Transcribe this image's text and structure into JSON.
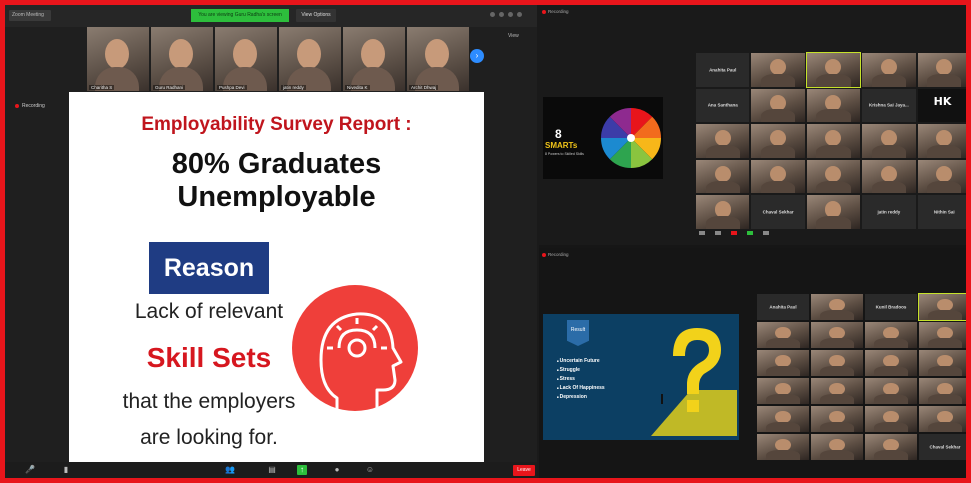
{
  "colors": {
    "border": "#e8151b",
    "share_banner": "#2dbe3c",
    "slide_title": "#c0151d",
    "reason_box": "#1f3c83",
    "skill_sets": "#d6171f",
    "head_circle": "#ef3f3a",
    "zoom_blue": "#2d8cff"
  },
  "left": {
    "zoom_badge": "Zoom Meeting",
    "share_banner": "You are viewing Guru Radha's screen",
    "view_options": "View Options",
    "view_button": "View",
    "recording": "Recording",
    "thumbnails": [
      {
        "name": "Charitha S"
      },
      {
        "name": "Guru Radhani"
      },
      {
        "name": "Pushpa Devi"
      },
      {
        "name": "jatin reddy"
      },
      {
        "name": "Nivedita K"
      },
      {
        "name": "Archit Dhwaj"
      }
    ],
    "slide": {
      "title": "Employability Survey Report :",
      "headline": "80% Graduates Unemployable",
      "reason_label": "Reason",
      "line1": "Lack of  relevant",
      "line2": "Skill Sets",
      "line3": "that the employers",
      "line4": "are looking for."
    },
    "end_button": "Leave",
    "toolbar_icons": [
      "mute-icon",
      "video-icon",
      "participants-icon",
      "chat-icon",
      "share-screen-icon",
      "record-icon",
      "reactions-icon"
    ]
  },
  "right": {
    "pane1": {
      "recording": "Recording",
      "smarts": {
        "number": "8",
        "label": "SMARTs",
        "subtitle": "8 Powers to Skilled Skills"
      },
      "tiles": [
        {
          "kind": "name",
          "label": "Anahita Paul"
        },
        {
          "kind": "video",
          "label": ""
        },
        {
          "kind": "video",
          "label": "",
          "highlight": true
        },
        {
          "kind": "video",
          "label": ""
        },
        {
          "kind": "video",
          "label": ""
        },
        {
          "kind": "name",
          "label": "Ana Santhana"
        },
        {
          "kind": "video",
          "label": ""
        },
        {
          "kind": "video",
          "label": ""
        },
        {
          "kind": "name",
          "label": "Krishna Sai Jaya..."
        },
        {
          "kind": "logo",
          "label": "HK"
        },
        {
          "kind": "video",
          "label": ""
        },
        {
          "kind": "video",
          "label": ""
        },
        {
          "kind": "video",
          "label": ""
        },
        {
          "kind": "video",
          "label": ""
        },
        {
          "kind": "video",
          "label": ""
        },
        {
          "kind": "video",
          "label": ""
        },
        {
          "kind": "video",
          "label": ""
        },
        {
          "kind": "video",
          "label": ""
        },
        {
          "kind": "video",
          "label": ""
        },
        {
          "kind": "video",
          "label": ""
        },
        {
          "kind": "video",
          "label": ""
        },
        {
          "kind": "name",
          "label": "Chaval Sekhar"
        },
        {
          "kind": "video",
          "label": ""
        },
        {
          "kind": "name",
          "label": "jatin reddy"
        },
        {
          "kind": "name",
          "label": "Nithin Sai"
        }
      ]
    },
    "pane2": {
      "recording": "Recording",
      "result": {
        "tag": "Result",
        "items": [
          "Uncertain Future",
          "Struggle",
          "Stress",
          "Lack Of Happiness",
          "Depression"
        ]
      },
      "tiles": [
        {
          "kind": "name",
          "label": "Anahita Paul"
        },
        {
          "kind": "video",
          "label": ""
        },
        {
          "kind": "name",
          "label": "Kunil Bradoos"
        },
        {
          "kind": "video",
          "label": "",
          "highlight": true
        },
        {
          "kind": "video",
          "label": ""
        },
        {
          "kind": "video",
          "label": ""
        },
        {
          "kind": "video",
          "label": ""
        },
        {
          "kind": "video",
          "label": ""
        },
        {
          "kind": "video",
          "label": ""
        },
        {
          "kind": "video",
          "label": ""
        },
        {
          "kind": "video",
          "label": ""
        },
        {
          "kind": "video",
          "label": ""
        },
        {
          "kind": "video",
          "label": ""
        },
        {
          "kind": "video",
          "label": ""
        },
        {
          "kind": "video",
          "label": ""
        },
        {
          "kind": "video",
          "label": ""
        },
        {
          "kind": "video",
          "label": ""
        },
        {
          "kind": "video",
          "label": ""
        },
        {
          "kind": "video",
          "label": ""
        },
        {
          "kind": "video",
          "label": ""
        },
        {
          "kind": "video",
          "label": ""
        },
        {
          "kind": "video",
          "label": ""
        },
        {
          "kind": "video",
          "label": ""
        },
        {
          "kind": "name",
          "label": "Chaval Sekhar"
        }
      ]
    }
  }
}
